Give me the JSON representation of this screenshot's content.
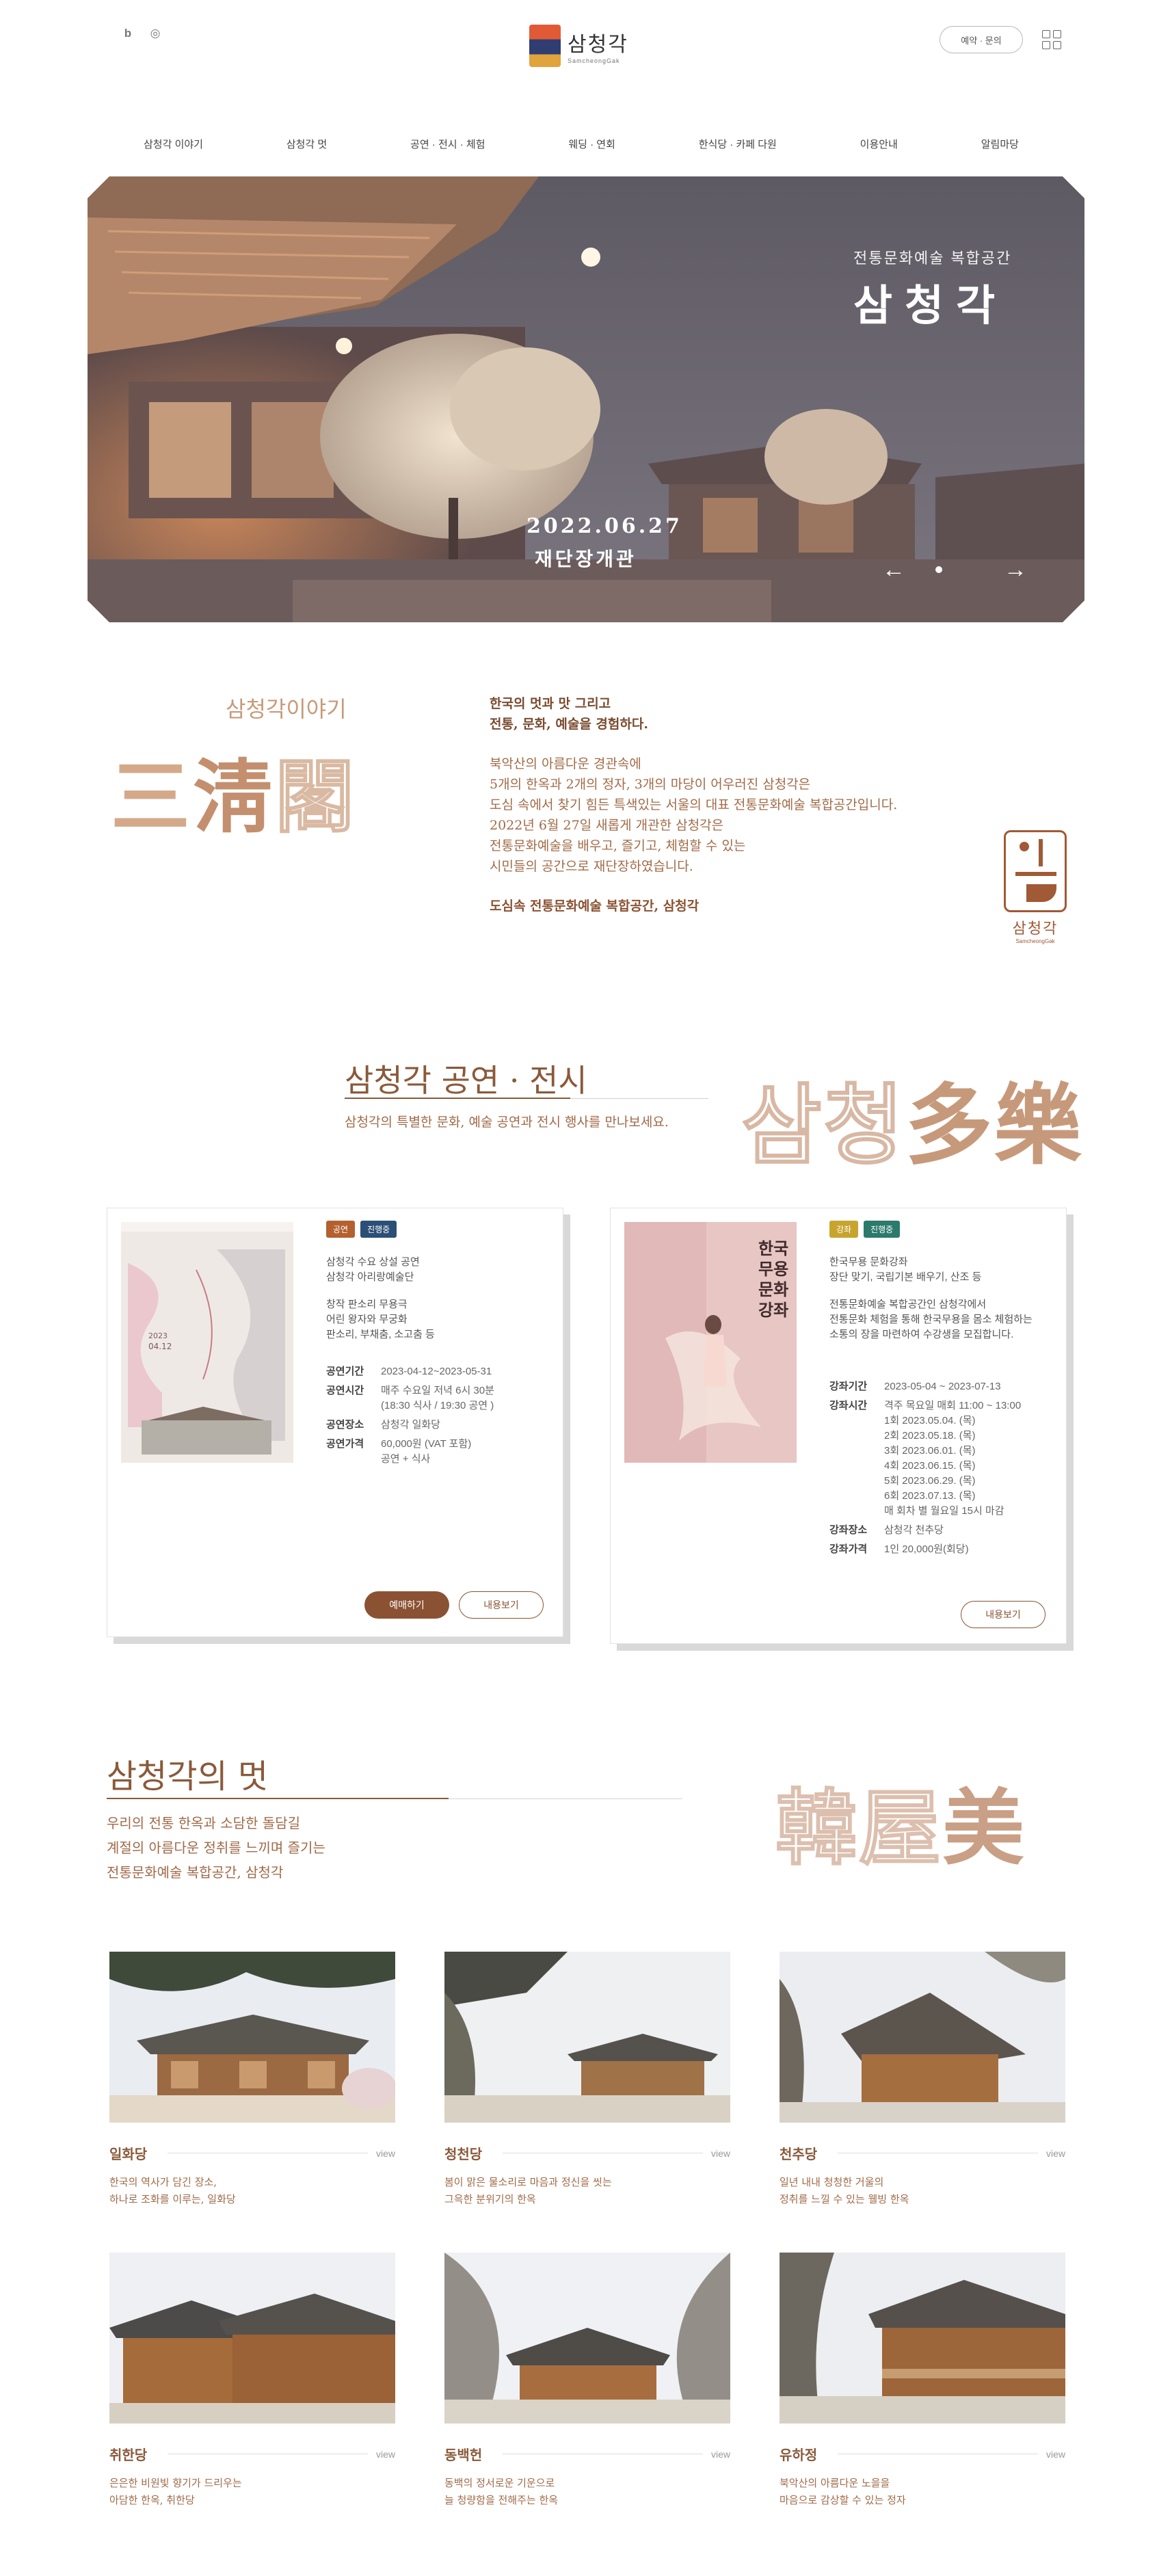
{
  "header": {
    "social": [
      "b",
      "◎"
    ],
    "logo_ko": "삼청각",
    "logo_en": "SamcheongGak",
    "reserve_label": "예약 · 문의"
  },
  "nav": [
    "삼청각 이야기",
    "삼청각 멋",
    "공연 · 전시 · 체험",
    "웨딩 · 연회",
    "한식당 · 카페 다원",
    "이용안내",
    "알림마당"
  ],
  "hero": {
    "subtitle": "전통문화예술 복합공간",
    "title": "삼청각",
    "date": "2022.06.27",
    "location": "재단장개관",
    "prev": "←",
    "next": "→"
  },
  "story": {
    "label": "삼청각이야기",
    "hanja": [
      "三",
      "淸",
      "閣"
    ],
    "lead": [
      "한국의 멋과 맛 그리고",
      "전통, 문화, 예술을 경험하다."
    ],
    "body": [
      "북악산의 아름다운 경관속에",
      "5개의 한옥과 2개의 정자, 3개의 마당이 어우러진 삼청각은",
      "도심 속에서 찾기 힘든 특색있는 서울의 대표 전통문화예술 복합공간입니다.",
      "2022년 6월 27일 새롭게 개관한 삼청각은",
      "전통문화예술을 배우고, 즐기고, 체험할 수 있는",
      "시민들의 공간으로 재단장하였습니다."
    ],
    "tail": "도심속 전통문화예술 복합공간, 삼청각",
    "emblem_ko": "삼청각",
    "emblem_en": "SamcheongGak"
  },
  "performances": {
    "title": "삼청각 공연 · 전시",
    "subtitle": "삼청각의 특별한 문화, 예술 공연과 전시 행사를 만나보세요.",
    "deco_outline": "삼청",
    "deco_fill": "多樂",
    "cards": [
      {
        "badges": [
          "공연",
          "진행중"
        ],
        "intro": [
          "삼청각 수요 상설 공연",
          "삼청각 아리랑예술단",
          "",
          "창작 판소리 무용극",
          "어린 왕자와 무궁화",
          "판소리, 부채춤, 소고춤 등"
        ],
        "rows": [
          {
            "k": "공연기간",
            "v": "2023-04-12~2023-05-31"
          },
          {
            "k": "공연시간",
            "v": "매주 수요일 저녁 6시 30분\n(18:30 식사 / 19:30 공연 )"
          },
          {
            "k": "공연장소",
            "v": "삼청각 일화당"
          },
          {
            "k": "공연가격",
            "v": "60,000원 (VAT 포함)\n공연 + 식사"
          }
        ],
        "btn_reserve": "예매하기",
        "btn_view": "내용보기"
      },
      {
        "badges": [
          "강좌",
          "진행중"
        ],
        "intro": [
          "한국무용 문화강좌",
          "장단 맞기, 국립기본 배우기, 산조 등",
          "",
          "전통문화예술 복합공간인 삼청각에서",
          "전통문화 체험을 통해 한국무용을 몸소 체험하는",
          "소통의 장을 마련하여 수강생을 모집합니다."
        ],
        "rows": [
          {
            "k": "강좌기간",
            "v": "2023-05-04 ~ 2023-07-13"
          },
          {
            "k": "강좌시간",
            "v": "격주 목요일 매회 11:00 ~ 13:00\n1회 2023.05.04. (목)\n2회 2023.05.18. (목)\n3회 2023.06.01. (목)\n4회 2023.06.15. (목)\n5회 2023.06.29. (목)\n6회 2023.07.13. (목)\n매 회차 별 월요일 15시 마감"
          },
          {
            "k": "강좌장소",
            "v": "삼청각 천추당"
          },
          {
            "k": "강좌가격",
            "v": "1인 20,000원(회당)"
          }
        ],
        "poster_title": "한국무용\n문화강좌",
        "btn_view": "내용보기"
      }
    ]
  },
  "beauty": {
    "title": "삼청각의 멋",
    "subtitle": [
      "우리의 전통 한옥과 소담한 돌담길",
      "계절의 아름다운 정취를 느끼며 즐기는",
      "전통문화예술 복합공간, 삼청각"
    ],
    "deco_outline": "韓屋",
    "deco_fill": "美",
    "view_label": "view",
    "buildings": [
      {
        "name": "일화당",
        "desc": [
          "한국의 역사가 담긴 장소,",
          "하나로 조화를 이루는, 일화당"
        ]
      },
      {
        "name": "청천당",
        "desc": [
          "봄이 맑은 물소리로 마음과 정신을 씻는",
          "그윽한 분위기의 한옥"
        ]
      },
      {
        "name": "천추당",
        "desc": [
          "일년 내내 청청한 거울의",
          "정취를 느낄 수 있는 웰빙 한옥"
        ]
      },
      {
        "name": "취한당",
        "desc": [
          "은은한 비원빛 향기가 드리우는",
          "아담한 한옥, 취한당"
        ]
      },
      {
        "name": "동백헌",
        "desc": [
          "동백의 정서로운 기운으로",
          "늘 청량함을 전해주는 한옥"
        ]
      },
      {
        "name": "유하정",
        "desc": [
          "북악산의 아름다운 노을을",
          "마음으로 감상할 수 있는 정자"
        ]
      }
    ]
  }
}
